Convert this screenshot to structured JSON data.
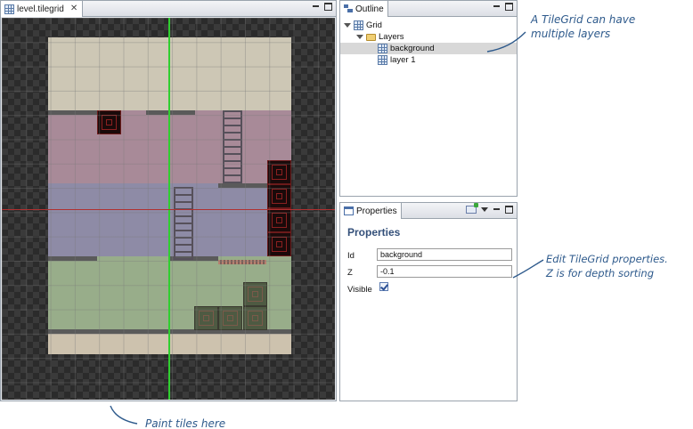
{
  "editor": {
    "tab_title": "level.tilegrid"
  },
  "outline": {
    "tab_title": "Outline",
    "tree": [
      {
        "label": "Grid",
        "icon": "grid-icon",
        "level": 0
      },
      {
        "label": "Layers",
        "icon": "folder-icon",
        "level": 1
      },
      {
        "label": "background",
        "icon": "grid-icon",
        "level": 2,
        "selected": true
      },
      {
        "label": "layer 1",
        "icon": "grid-icon",
        "level": 2,
        "selected": false
      }
    ]
  },
  "properties": {
    "tab_title": "Properties",
    "heading": "Properties",
    "fields": {
      "id_label": "Id",
      "id_value": "background",
      "z_label": "Z",
      "z_value": "-0.1",
      "visible_label": "Visible",
      "visible_checked": true
    }
  },
  "annotations": {
    "layers_note": [
      "A TileGrid can have",
      "multiple layers"
    ],
    "props_note": [
      "Edit TileGrid properties.",
      "Z is for depth sorting"
    ],
    "paint_note": "Paint tiles here"
  },
  "colors": {
    "annotation": "#2e5a8c",
    "cursor_vertical": "#2fcf2f",
    "cursor_horizontal": "#b03030",
    "selection": "#d8d8d8"
  }
}
